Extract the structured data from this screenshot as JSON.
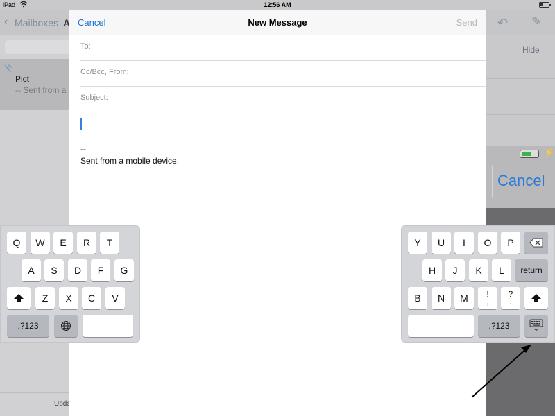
{
  "status_bar": {
    "device": "iPad",
    "wifi_icon": "wifi-icon",
    "time": "12:56 AM",
    "battery_icon": "battery-icon"
  },
  "mail_background": {
    "back_label": "Mailboxes",
    "account_label": "A",
    "message_sender": "Pict",
    "message_preview": "-- Sent from a",
    "bottom_status": "Upda",
    "hide_label": "Hide"
  },
  "overlay": {
    "cancel_label": "Cancel"
  },
  "compose": {
    "cancel_label": "Cancel",
    "title": "New Message",
    "send_label": "Send",
    "to_label": "To:",
    "cc_label": "Cc/Bcc, From:",
    "subject_label": "Subject:",
    "signature_dashes": "--",
    "signature_text": "Sent from a mobile device."
  },
  "keyboard": {
    "left": {
      "row1": [
        "Q",
        "W",
        "E",
        "R",
        "T"
      ],
      "row2": [
        "A",
        "S",
        "D",
        "F",
        "G"
      ],
      "row3": [
        "Z",
        "X",
        "C",
        "V"
      ],
      "numbers_label": ".?123"
    },
    "right": {
      "row1": [
        "Y",
        "U",
        "I",
        "O",
        "P"
      ],
      "row2": [
        "H",
        "J",
        "K",
        "L"
      ],
      "return_label": "return",
      "row3": [
        "B",
        "N",
        "M"
      ],
      "exclaim_top": "!",
      "exclaim_bottom": ",",
      "question_top": "?",
      "question_bottom": ".",
      "numbers_label": ".?123"
    }
  }
}
